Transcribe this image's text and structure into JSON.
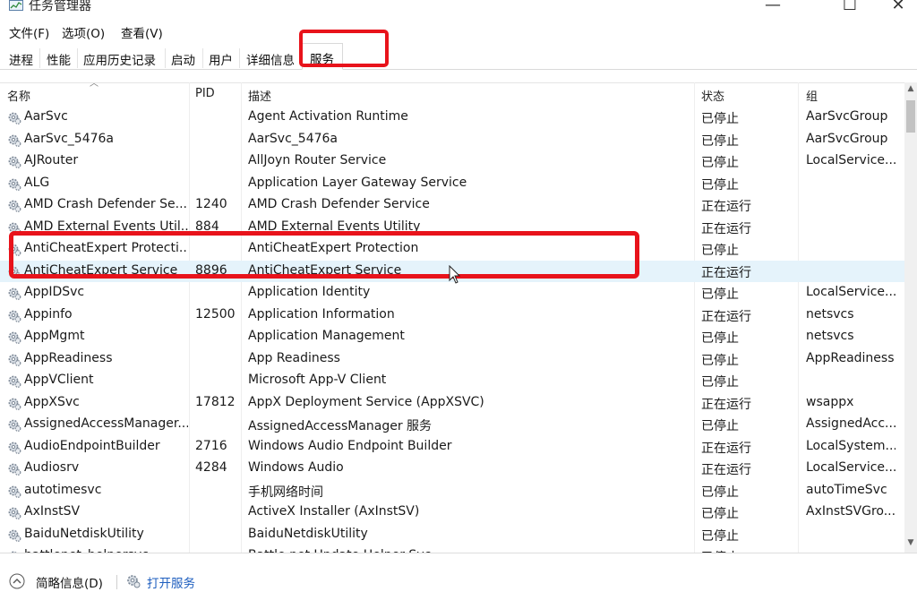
{
  "window": {
    "title": "任务管理器",
    "controls": {
      "minimize": "—",
      "maximize": "☐",
      "close": "✕"
    }
  },
  "menu": {
    "items": [
      "文件(F)",
      "选项(O)",
      "查看(V)"
    ]
  },
  "tabs": {
    "items": [
      "进程",
      "性能",
      "应用历史记录",
      "启动",
      "用户",
      "详细信息",
      "服务"
    ],
    "active": "服务"
  },
  "columns": {
    "name": "名称",
    "pid": "PID",
    "description": "描述",
    "status": "状态",
    "group": "组"
  },
  "services": [
    {
      "name": "AarSvc",
      "pid": "",
      "description": "Agent Activation Runtime",
      "status": "已停止",
      "group": "AarSvcGroup"
    },
    {
      "name": "AarSvc_5476a",
      "pid": "",
      "description": "AarSvc_5476a",
      "status": "已停止",
      "group": "AarSvcGroup"
    },
    {
      "name": "AJRouter",
      "pid": "",
      "description": "AllJoyn Router Service",
      "status": "已停止",
      "group": "LocalService..."
    },
    {
      "name": "ALG",
      "pid": "",
      "description": "Application Layer Gateway Service",
      "status": "已停止",
      "group": ""
    },
    {
      "name": "AMD Crash Defender Se...",
      "pid": "1240",
      "description": "AMD Crash Defender Service",
      "status": "正在运行",
      "group": ""
    },
    {
      "name": "AMD External Events Util...",
      "pid": "884",
      "description": "AMD External Events Utility",
      "status": "正在运行",
      "group": ""
    },
    {
      "name": "AntiCheatExpert Protecti...",
      "pid": "",
      "description": "AntiCheatExpert Protection",
      "status": "已停止",
      "group": ""
    },
    {
      "name": "AntiCheatExpert Service",
      "pid": "8896",
      "description": "AntiCheatExpert Service",
      "status": "正在运行",
      "group": ""
    },
    {
      "name": "AppIDSvc",
      "pid": "",
      "description": "Application Identity",
      "status": "已停止",
      "group": "LocalService..."
    },
    {
      "name": "Appinfo",
      "pid": "12500",
      "description": "Application Information",
      "status": "正在运行",
      "group": "netsvcs"
    },
    {
      "name": "AppMgmt",
      "pid": "",
      "description": "Application Management",
      "status": "已停止",
      "group": "netsvcs"
    },
    {
      "name": "AppReadiness",
      "pid": "",
      "description": "App Readiness",
      "status": "已停止",
      "group": "AppReadiness"
    },
    {
      "name": "AppVClient",
      "pid": "",
      "description": "Microsoft App-V Client",
      "status": "已停止",
      "group": ""
    },
    {
      "name": "AppXSvc",
      "pid": "17812",
      "description": "AppX Deployment Service (AppXSVC)",
      "status": "正在运行",
      "group": "wsappx"
    },
    {
      "name": "AssignedAccessManager...",
      "pid": "",
      "description": "AssignedAccessManager 服务",
      "status": "已停止",
      "group": "AssignedAcc..."
    },
    {
      "name": "AudioEndpointBuilder",
      "pid": "2716",
      "description": "Windows Audio Endpoint Builder",
      "status": "正在运行",
      "group": "LocalSystem..."
    },
    {
      "name": "Audiosrv",
      "pid": "4284",
      "description": "Windows Audio",
      "status": "正在运行",
      "group": "LocalService..."
    },
    {
      "name": "autotimesvc",
      "pid": "",
      "description": "手机网络时间",
      "status": "已停止",
      "group": "autoTimeSvc"
    },
    {
      "name": "AxInstSV",
      "pid": "",
      "description": "ActiveX Installer (AxInstSV)",
      "status": "已停止",
      "group": "AxInstSVGro..."
    },
    {
      "name": "BaiduNetdiskUtility",
      "pid": "",
      "description": "BaiduNetdiskUtility",
      "status": "已停止",
      "group": ""
    },
    {
      "name": "battlenet_helpersvc",
      "pid": "",
      "description": "Battle.net Update Helper Svc",
      "status": "已停止",
      "group": ""
    }
  ],
  "selected_service": "AntiCheatExpert Service",
  "footer": {
    "fewer_details": "简略信息(D)",
    "open_services": "打开服务"
  },
  "colors": {
    "highlight": "#e8131b",
    "selection": "#e5f3fb",
    "link": "#1f5fbf"
  }
}
